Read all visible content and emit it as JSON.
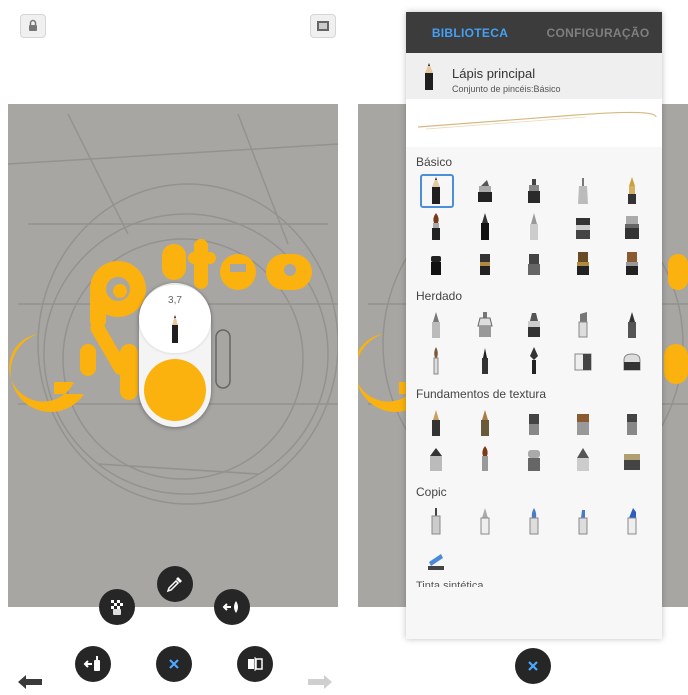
{
  "left": {
    "canvas": {
      "art_text_top": "rte",
      "art_text_left": "G",
      "art_letter_o": "o"
    },
    "brush_puck": {
      "size_value": "3,7",
      "color": "#FBB20E"
    },
    "icons": {
      "top_left": "lock-rotation-icon",
      "top_right": "fullscreen-icon",
      "undo": "undo-arrow-icon",
      "redo": "redo-arrow-icon",
      "eyedropper": "eyedropper-icon",
      "transparent_fill": "checker-paint-bucket-icon",
      "fill": "fill-drop-icon",
      "brush_options": "brush-options-icon",
      "close": "close-x-icon",
      "mirror": "symmetry-icon"
    }
  },
  "right": {
    "tabs": [
      {
        "label": "BIBLIOTECA",
        "active": true
      },
      {
        "label": "CONFIGURAÇÃO",
        "active": false
      }
    ],
    "current_brush": {
      "name": "Lápis principal",
      "set": "Conjunto de pincéis:Básico"
    },
    "sections": [
      {
        "title": "Básico",
        "count": 15
      },
      {
        "title": "Herdado",
        "count": 10
      },
      {
        "title": "Fundamentos de textura",
        "count": 10
      },
      {
        "title": "Copic",
        "count": 6
      }
    ],
    "cut_section": "Tinta sintética",
    "colors": {
      "accent": "#43A0F5",
      "panel_bg": "#F7F7F7",
      "tab_bar": "#3C3C3C"
    }
  }
}
